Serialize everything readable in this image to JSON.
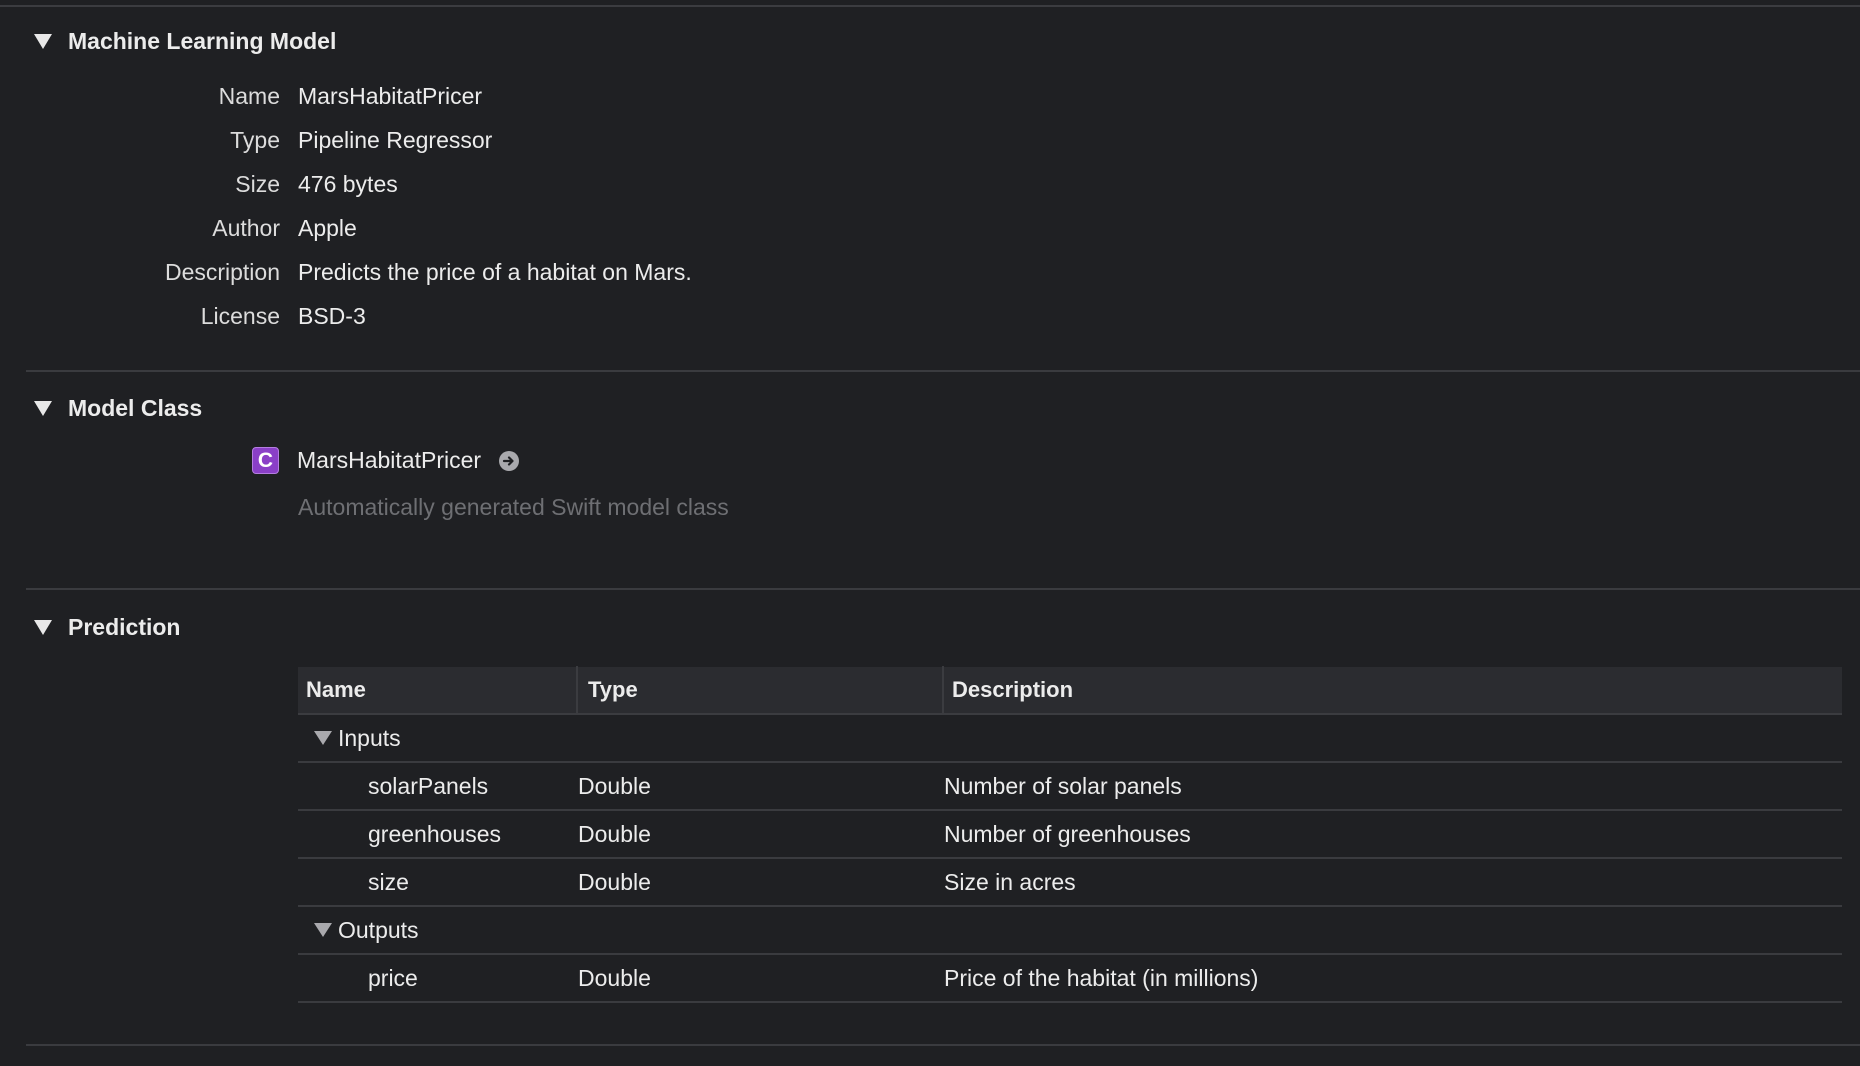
{
  "sections": {
    "model": {
      "title": "Machine Learning Model",
      "fields": [
        {
          "label": "Name",
          "value": "MarsHabitatPricer"
        },
        {
          "label": "Type",
          "value": "Pipeline Regressor"
        },
        {
          "label": "Size",
          "value": "476 bytes"
        },
        {
          "label": "Author",
          "value": "Apple"
        },
        {
          "label": "Description",
          "value": "Predicts the price of a habitat on Mars."
        },
        {
          "label": "License",
          "value": "BSD-3"
        }
      ]
    },
    "model_class": {
      "title": "Model Class",
      "badge": "C",
      "class_name": "MarsHabitatPricer",
      "subtitle": "Automatically generated Swift model class"
    },
    "prediction": {
      "title": "Prediction",
      "columns": [
        "Name",
        "Type",
        "Description"
      ],
      "groups": [
        {
          "label": "Inputs",
          "rows": [
            {
              "name": "solarPanels",
              "type": "Double",
              "description": "Number of solar panels"
            },
            {
              "name": "greenhouses",
              "type": "Double",
              "description": "Number of greenhouses"
            },
            {
              "name": "size",
              "type": "Double",
              "description": "Size in acres"
            }
          ]
        },
        {
          "label": "Outputs",
          "rows": [
            {
              "name": "price",
              "type": "Double",
              "description": "Price of the habitat (in millions)"
            }
          ]
        }
      ]
    }
  },
  "colors": {
    "background": "#1f2023",
    "badge": "#8a3fc7",
    "muted_text": "#6e6f73"
  },
  "icons": {
    "disclosure": "triangle-down-icon",
    "class_badge": "class-c-icon",
    "navigate": "arrow-circle-right-icon"
  }
}
